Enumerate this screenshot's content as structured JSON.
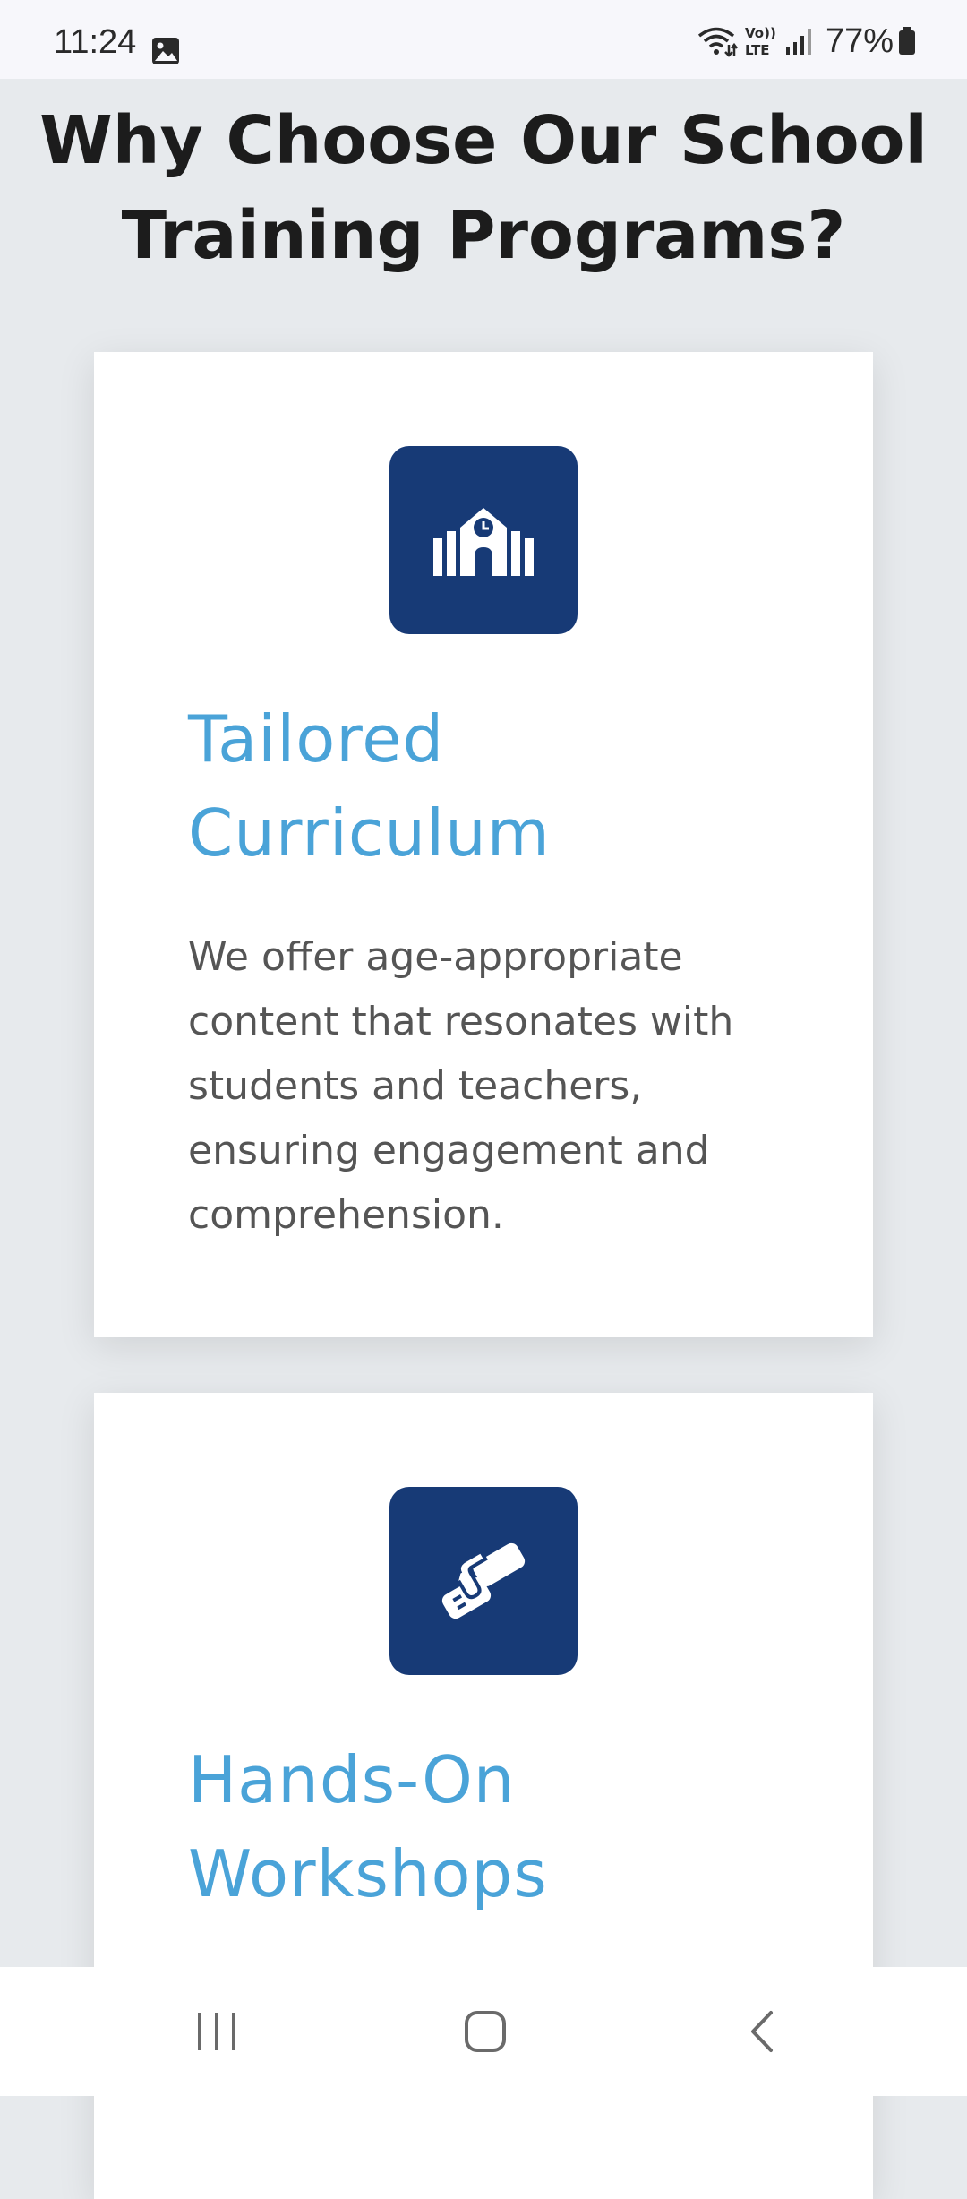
{
  "status_bar": {
    "time": "11:24",
    "battery": "77%",
    "icons": [
      "gallery-icon",
      "wifi-icon",
      "volte-icon",
      "signal-icon",
      "battery-icon"
    ],
    "volte_label_top": "Vo))",
    "volte_label_bottom": "LTE"
  },
  "page": {
    "title_line1": "Why Choose Our School",
    "title_line2": "Training Programs?"
  },
  "cards": [
    {
      "icon": "school-icon",
      "title_line1": "Tailored",
      "title_line2": "Curriculum",
      "text": "We offer age-appropriate content that resonates with students and teachers, ensuring engagement and comprehension."
    },
    {
      "icon": "handshake-icon",
      "title_line1": "Hands-On",
      "title_line2": "Workshops"
    }
  ],
  "colors": {
    "background": "#e7eaed",
    "icon_box": "#173a76",
    "card_title": "#4aa3d8",
    "body_text": "#555555"
  },
  "nav_bar": {
    "icons": [
      "recents-icon",
      "home-icon",
      "back-icon"
    ]
  }
}
